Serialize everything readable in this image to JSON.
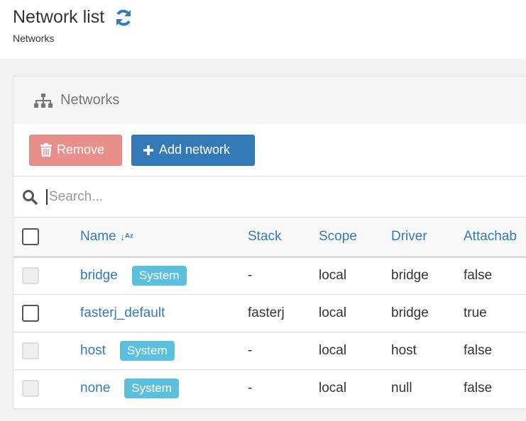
{
  "header": {
    "title": "Network list",
    "breadcrumb": "Networks"
  },
  "panel": {
    "title": "Networks"
  },
  "toolbar": {
    "remove_label": "Remove",
    "add_label": "Add network"
  },
  "search": {
    "placeholder": "Search...",
    "value": ""
  },
  "table": {
    "columns": [
      "Name",
      "Stack",
      "Scope",
      "Driver",
      "Attachab"
    ],
    "rows": [
      {
        "name": "bridge",
        "badge": "System",
        "stack": "-",
        "scope": "local",
        "driver": "bridge",
        "attachable": "false"
      },
      {
        "name": "fasterj_default",
        "badge": "",
        "stack": "fasterj",
        "scope": "local",
        "driver": "bridge",
        "attachable": "true"
      },
      {
        "name": "host",
        "badge": "System",
        "stack": "-",
        "scope": "local",
        "driver": "host",
        "attachable": "false"
      },
      {
        "name": "none",
        "badge": "System",
        "stack": "-",
        "scope": "local",
        "driver": "null",
        "attachable": "false"
      }
    ]
  },
  "colors": {
    "primary": "#337ab7",
    "danger": "#e88f8c",
    "info": "#5bc0de"
  }
}
